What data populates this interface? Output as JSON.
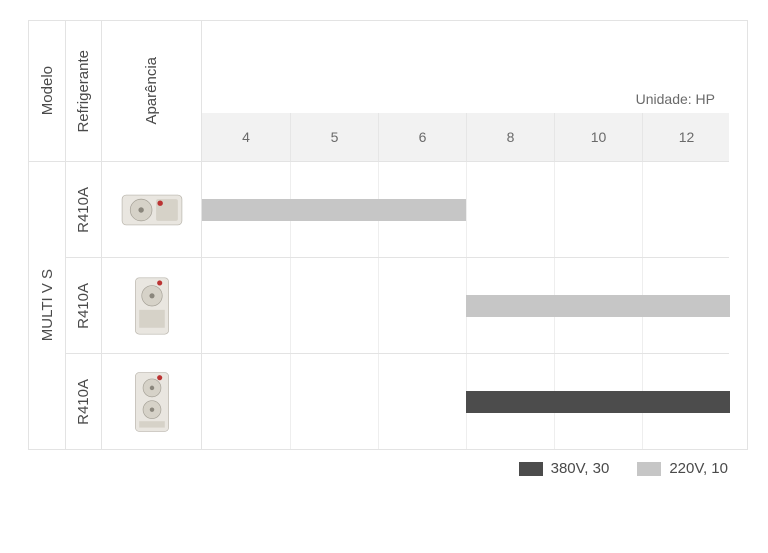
{
  "headers": {
    "modelo": "Modelo",
    "refrigerante": "Refrigerante",
    "aparencia": "Aparência",
    "unit": "Unidade: HP"
  },
  "scale_ticks": [
    "4",
    "5",
    "6",
    "8",
    "10",
    "12"
  ],
  "model_label": "MULTI V S",
  "rows": [
    {
      "refrigerant": "R410A",
      "product_icon": "ac-unit-horizontal",
      "bar_color": "light",
      "bar_start_col": 0,
      "bar_span_cols": 3
    },
    {
      "refrigerant": "R410A",
      "product_icon": "ac-unit-vertical-single",
      "bar_color": "light",
      "bar_start_col": 3,
      "bar_span_cols": 3
    },
    {
      "refrigerant": "R410A",
      "product_icon": "ac-unit-vertical-double",
      "bar_color": "dark",
      "bar_start_col": 3,
      "bar_span_cols": 3
    }
  ],
  "legend": {
    "dark": "380V, 30",
    "light": "220V, 10"
  },
  "chart_data": {
    "type": "bar",
    "title": "",
    "xlabel": "Unidade: HP",
    "ylabel": "",
    "x_ticks": [
      4,
      5,
      6,
      8,
      10,
      12
    ],
    "categories": [
      "MULTI V S – R410A (1)",
      "MULTI V S – R410A (2)",
      "MULTI V S – R410A (3)"
    ],
    "series": [
      {
        "name": "220V, 10",
        "ranges": [
          [
            4,
            6
          ],
          [
            8,
            12
          ],
          null
        ]
      },
      {
        "name": "380V, 30",
        "ranges": [
          null,
          null,
          [
            8,
            12
          ]
        ]
      }
    ]
  }
}
